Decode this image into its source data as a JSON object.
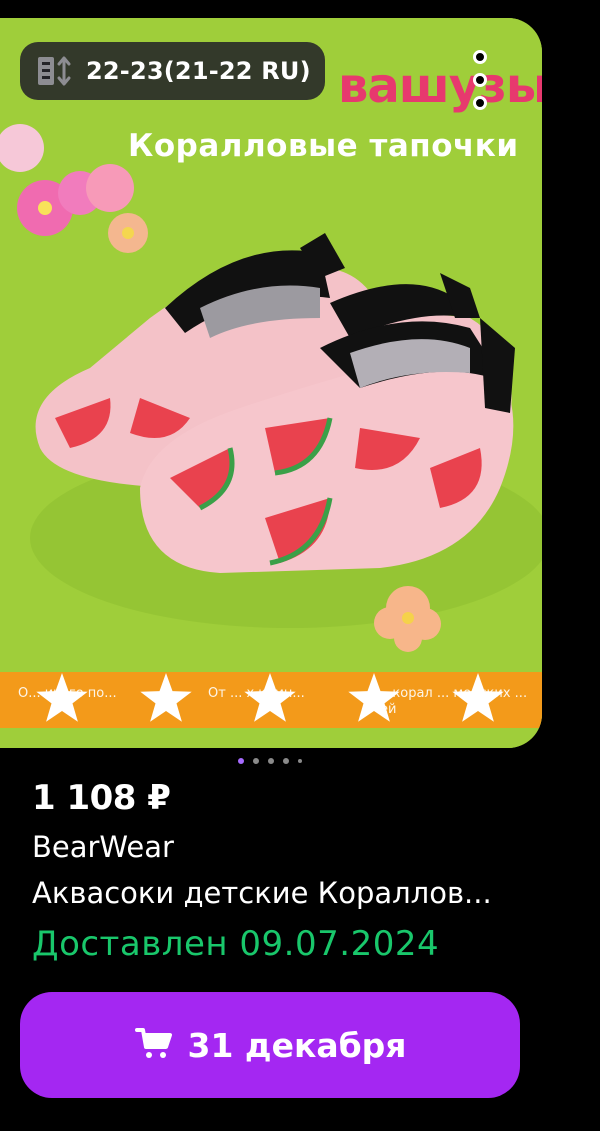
{
  "product_image": {
    "brand_text": "вашузы",
    "subtitle": "Коралловые тапочки",
    "features": [
      "О... ичего по...",
      "От ... х камн...",
      "...корал ... морских ... ей"
    ],
    "size_badge": {
      "icon": "ruler-size-icon",
      "label": "22-23(21-22 RU)"
    },
    "more_icon": "more-vertical-icon",
    "pager": {
      "count": 5,
      "active_index": 0
    },
    "rating_stars": 5
  },
  "product": {
    "price": "1 108 ₽",
    "brand": "BearWear",
    "title": "Аквасоки детские Кораллов...",
    "delivery_status": "Доставлен 09.07.2024"
  },
  "cart_button": {
    "icon": "cart-icon",
    "label": "31 декабря"
  },
  "colors": {
    "accent": "#a427f2",
    "delivered": "#19c76b",
    "image_bg": "#9fce3a"
  }
}
